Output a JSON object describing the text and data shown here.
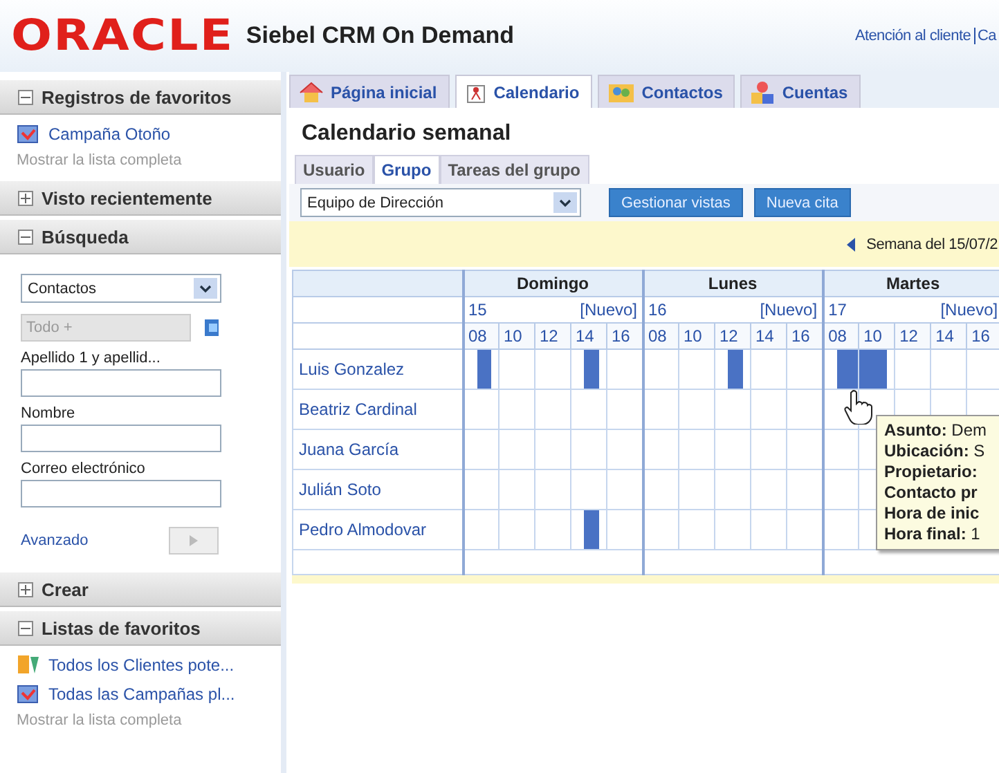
{
  "header": {
    "logo": "ORACLE",
    "product": "Siebel CRM On Demand",
    "links": [
      "Atención al cliente",
      "Ca"
    ]
  },
  "sidebar": [
    {
      "title": "Registros de favoritos",
      "expanded": true,
      "kind": "links",
      "items": [
        {
          "label": "Campaña Otoño",
          "kind": "campaign"
        }
      ],
      "more": "Mostrar la lista completa"
    },
    {
      "title": "Visto recientemente",
      "expanded": false
    },
    {
      "title": "Búsqueda",
      "expanded": true,
      "kind": "search",
      "search": {
        "object": "Contactos",
        "scope": "Todo +",
        "scope_disabled": true,
        "fields": [
          {
            "label": "Apellido 1 y apellid..."
          },
          {
            "label": "Nombre"
          },
          {
            "label": "Correo electrónico"
          }
        ],
        "advanced": "Avanzado",
        "go_disabled": true
      }
    },
    {
      "title": "Crear",
      "expanded": false
    },
    {
      "title": "Listas de favoritos",
      "expanded": true,
      "kind": "links",
      "items": [
        {
          "label": "Todos los Clientes pote...",
          "kind": "lead"
        },
        {
          "label": "Todas las Campañas pl...",
          "kind": "campaign"
        }
      ],
      "more": "Mostrar la lista completa"
    }
  ],
  "tabs": [
    {
      "label": "Página inicial",
      "selected": false
    },
    {
      "label": "Calendario",
      "selected": true
    },
    {
      "label": "Contactos",
      "selected": false
    },
    {
      "label": "Cuentas",
      "selected": false
    }
  ],
  "page_title": "Calendario semanal",
  "subtabs": [
    {
      "label": "Usuario",
      "selected": false
    },
    {
      "label": "Grupo",
      "selected": true
    },
    {
      "label": "Tareas del grupo",
      "selected": false
    }
  ],
  "toolbar": {
    "view": "Equipo de Dirección",
    "buttons": [
      "Gestionar vistas",
      "Nueva cita"
    ]
  },
  "week_label": "Semana del 15/07/2",
  "calendar": {
    "days": [
      {
        "name": "Domingo",
        "date": "15",
        "new": "[Nuevo]",
        "hours": [
          "08",
          "10",
          "12",
          "14",
          "16"
        ]
      },
      {
        "name": "Lunes",
        "date": "16",
        "new": "[Nuevo]",
        "hours": [
          "08",
          "10",
          "12",
          "14",
          "16"
        ]
      },
      {
        "name": "Martes",
        "date": "17",
        "new": "[Nuevo]",
        "hours": [
          "08",
          "10",
          "12",
          "14",
          "16"
        ]
      }
    ],
    "rows": [
      {
        "name": "Luis Gonzalez",
        "slots": [
          [
            true,
            false,
            false,
            true,
            false
          ],
          [
            false,
            false,
            true,
            false,
            false
          ],
          [
            true,
            true,
            false,
            false,
            false
          ]
        ]
      },
      {
        "name": "Beatriz Cardinal",
        "slots": [
          [
            false,
            false,
            false,
            false,
            false
          ],
          [
            false,
            false,
            false,
            false,
            false
          ],
          [
            false,
            false,
            false,
            false,
            false
          ]
        ]
      },
      {
        "name": "Juana García",
        "slots": [
          [
            false,
            false,
            false,
            false,
            false
          ],
          [
            false,
            false,
            false,
            false,
            false
          ],
          [
            false,
            false
          ]
        ]
      },
      {
        "name": "Julián Soto",
        "slots": [
          [
            false,
            false,
            false,
            false,
            false
          ],
          [
            false,
            false,
            false,
            false,
            false
          ],
          [
            false,
            false
          ]
        ]
      },
      {
        "name": "Pedro Almodovar",
        "slots": [
          [
            false,
            false,
            false,
            true,
            false
          ],
          [
            false,
            false,
            false,
            false,
            false
          ],
          [
            false,
            false
          ]
        ]
      }
    ]
  },
  "tooltip": {
    "lines": [
      "**Asunto:** Dem",
      "**Ubicación:** S",
      "**Propietario:**",
      "**Contacto pr**",
      "**Hora de inic**",
      "**Hora final:** 1"
    ]
  }
}
